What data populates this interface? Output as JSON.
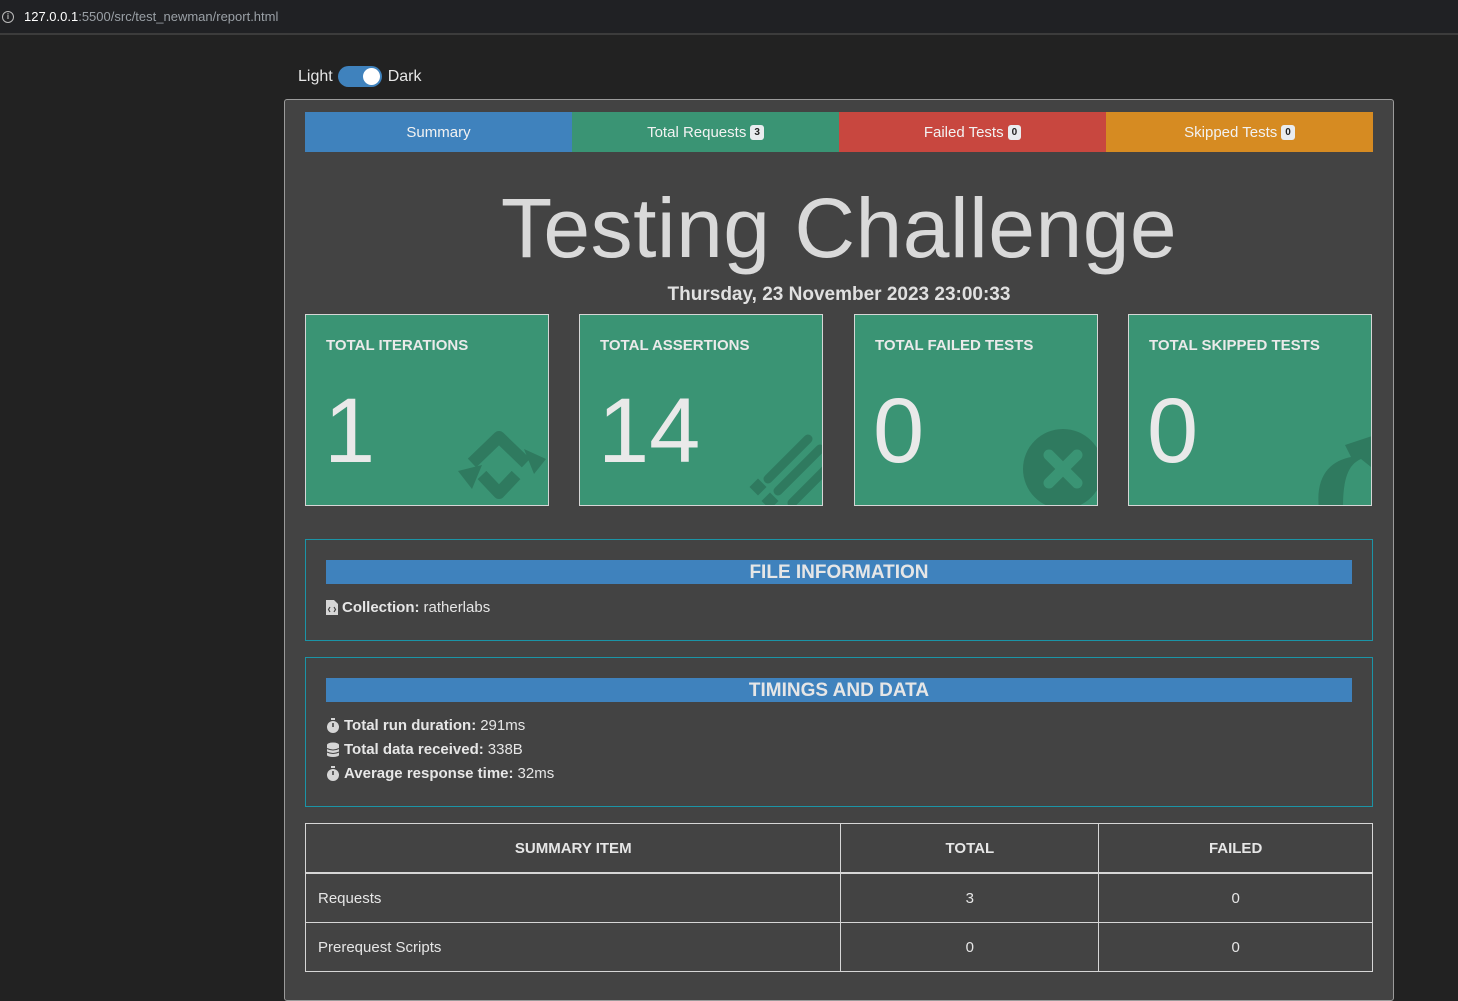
{
  "browser": {
    "url_host": "127.0.0.1",
    "url_path": ":5500/src/test_newman/report.html"
  },
  "theme": {
    "light_label": "Light",
    "dark_label": "Dark"
  },
  "tabs": [
    {
      "label": "Summary",
      "badge": null,
      "color": "#3f82bd"
    },
    {
      "label": "Total Requests",
      "badge": "3",
      "color": "#3a9474"
    },
    {
      "label": "Failed Tests",
      "badge": "0",
      "color": "#c8473f"
    },
    {
      "label": "Skipped Tests",
      "badge": "0",
      "color": "#d68b22"
    }
  ],
  "report": {
    "title": "Testing Challenge",
    "date": "Thursday, 23 November 2023 23:00:33"
  },
  "stats": [
    {
      "label": "TOTAL ITERATIONS",
      "value": "1",
      "icon": "sync-icon"
    },
    {
      "label": "TOTAL ASSERTIONS",
      "value": "14",
      "icon": "assertions-icon"
    },
    {
      "label": "TOTAL FAILED TESTS",
      "value": "0",
      "icon": "times-circle-icon"
    },
    {
      "label": "TOTAL SKIPPED TESTS",
      "value": "0",
      "icon": "share-icon"
    }
  ],
  "file_info": {
    "heading": "FILE INFORMATION",
    "collection_label": "Collection:",
    "collection_value": "ratherlabs"
  },
  "timings": {
    "heading": "TIMINGS AND DATA",
    "rows": [
      {
        "label": "Total run duration:",
        "value": "291ms",
        "icon": "stopwatch-icon"
      },
      {
        "label": "Total data received:",
        "value": "338B",
        "icon": "database-icon"
      },
      {
        "label": "Average response time:",
        "value": "32ms",
        "icon": "stopwatch-icon"
      }
    ]
  },
  "summary_table": {
    "headers": [
      "SUMMARY ITEM",
      "TOTAL",
      "FAILED"
    ],
    "rows": [
      [
        "Requests",
        "3",
        "0"
      ],
      [
        "Prerequest Scripts",
        "0",
        "0"
      ]
    ]
  }
}
